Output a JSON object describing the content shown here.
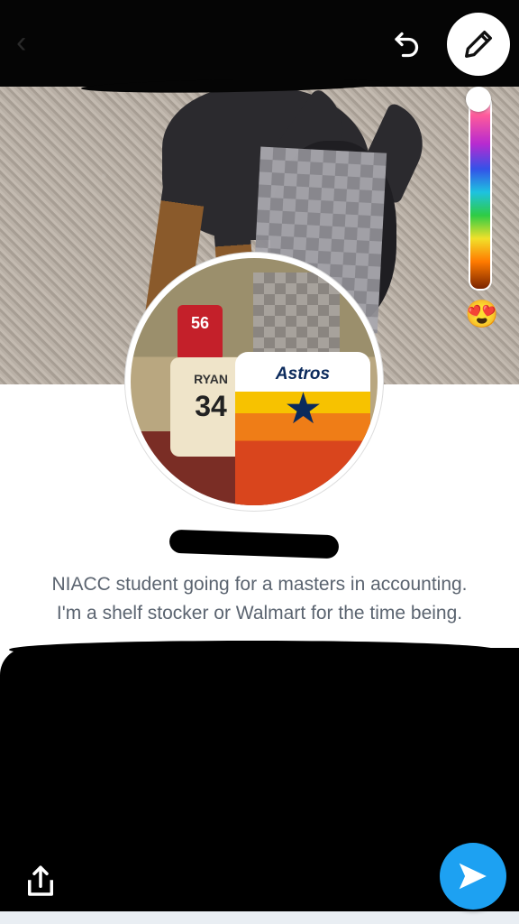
{
  "editor": {
    "emoji": "😍",
    "colors": {
      "accent": "#1DA1F2",
      "slider_top": "#ffffff",
      "slider_bottom": "#7a2400"
    }
  },
  "profile": {
    "avatar_jersey_red_number": "56",
    "avatar_jersey_white_name": "RYAN",
    "avatar_jersey_white_number": "34",
    "avatar_shirt_text": "Astros",
    "bio_line_1": "NIACC student going for a masters in accounting.",
    "bio_line_2": "I'm a shelf stocker or Walmart for the time being."
  },
  "icons": {
    "back": "back-arrow-icon",
    "undo": "undo-icon",
    "pencil": "pencil-icon",
    "share": "share-icon",
    "send": "send-icon"
  }
}
